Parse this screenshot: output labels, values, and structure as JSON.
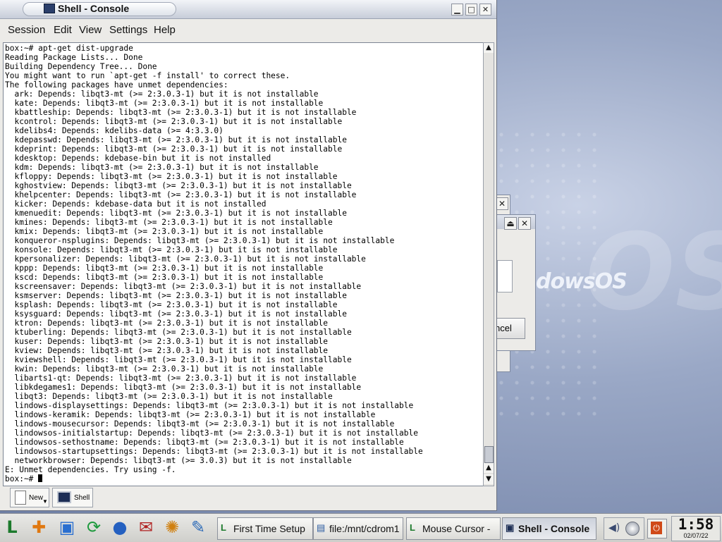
{
  "window": {
    "title": "Shell - Console",
    "controls": {
      "minimize": "▁",
      "maximize": "□",
      "close": "✕"
    }
  },
  "menubar": {
    "items": [
      "Session",
      "Edit",
      "View",
      "Settings",
      "Help"
    ]
  },
  "terminal": {
    "lines": [
      "box:~# apt-get dist-upgrade",
      "Reading Package Lists... Done",
      "Building Dependency Tree... Done",
      "You might want to run `apt-get -f install' to correct these.",
      "The following packages have unmet dependencies:",
      "  ark: Depends: libqt3-mt (>= 2:3.0.3-1) but it is not installable",
      "  kate: Depends: libqt3-mt (>= 2:3.0.3-1) but it is not installable",
      "  kbattleship: Depends: libqt3-mt (>= 2:3.0.3-1) but it is not installable",
      "  kcontrol: Depends: libqt3-mt (>= 2:3.0.3-1) but it is not installable",
      "  kdelibs4: Depends: kdelibs-data (>= 4:3.3.0)",
      "  kdepasswd: Depends: libqt3-mt (>= 2:3.0.3-1) but it is not installable",
      "  kdeprint: Depends: libqt3-mt (>= 2:3.0.3-1) but it is not installable",
      "  kdesktop: Depends: kdebase-bin but it is not installed",
      "  kdm: Depends: libqt3-mt (>= 2:3.0.3-1) but it is not installable",
      "  kfloppy: Depends: libqt3-mt (>= 2:3.0.3-1) but it is not installable",
      "  kghostview: Depends: libqt3-mt (>= 2:3.0.3-1) but it is not installable",
      "  khelpcenter: Depends: libqt3-mt (>= 2:3.0.3-1) but it is not installable",
      "  kicker: Depends: kdebase-data but it is not installed",
      "  kmenuedit: Depends: libqt3-mt (>= 2:3.0.3-1) but it is not installable",
      "  kmines: Depends: libqt3-mt (>= 2:3.0.3-1) but it is not installable",
      "  kmix: Depends: libqt3-mt (>= 2:3.0.3-1) but it is not installable",
      "  konqueror-nsplugins: Depends: libqt3-mt (>= 2:3.0.3-1) but it is not installable",
      "  konsole: Depends: libqt3-mt (>= 2:3.0.3-1) but it is not installable",
      "  kpersonalizer: Depends: libqt3-mt (>= 2:3.0.3-1) but it is not installable",
      "  kppp: Depends: libqt3-mt (>= 2:3.0.3-1) but it is not installable",
      "  kscd: Depends: libqt3-mt (>= 2:3.0.3-1) but it is not installable",
      "  kscreensaver: Depends: libqt3-mt (>= 2:3.0.3-1) but it is not installable",
      "  ksmserver: Depends: libqt3-mt (>= 2:3.0.3-1) but it is not installable",
      "  ksplash: Depends: libqt3-mt (>= 2:3.0.3-1) but it is not installable",
      "  ksysguard: Depends: libqt3-mt (>= 2:3.0.3-1) but it is not installable",
      "  ktron: Depends: libqt3-mt (>= 2:3.0.3-1) but it is not installable",
      "  ktuberling: Depends: libqt3-mt (>= 2:3.0.3-1) but it is not installable",
      "  kuser: Depends: libqt3-mt (>= 2:3.0.3-1) but it is not installable",
      "  kview: Depends: libqt3-mt (>= 2:3.0.3-1) but it is not installable",
      "  kviewshell: Depends: libqt3-mt (>= 2:3.0.3-1) but it is not installable",
      "  kwin: Depends: libqt3-mt (>= 2:3.0.3-1) but it is not installable",
      "  libarts1-qt: Depends: libqt3-mt (>= 2:3.0.3-1) but it is not installable",
      "  libkdegames1: Depends: libqt3-mt (>= 2:3.0.3-1) but it is not installable",
      "  libqt3: Depends: libqt3-mt (>= 2:3.0.3-1) but it is not installable",
      "  lindows-displaysettings: Depends: libqt3-mt (>= 2:3.0.3-1) but it is not installable",
      "  lindows-keramik: Depends: libqt3-mt (>= 2:3.0.3-1) but it is not installable",
      "  lindows-mousecursor: Depends: libqt3-mt (>= 2:3.0.3-1) but it is not installable",
      "  lindowsos-initialstartup: Depends: libqt3-mt (>= 2:3.0.3-1) but it is not installable",
      "  lindowsos-sethostname: Depends: libqt3-mt (>= 2:3.0.3-1) but it is not installable",
      "  lindowsos-startupsettings: Depends: libqt3-mt (>= 2:3.0.3-1) but it is not installable",
      "  networkbrowser: Depends: libqt3-mt (>= 3.0.3) but it is not installable",
      "E: Unmet dependencies. Try using -f.",
      "box:~# "
    ]
  },
  "scrollbar": {
    "up": "▲",
    "down": "▼",
    "down2": "▼▲"
  },
  "console_tabs": [
    {
      "label": "New",
      "icon": "new-doc-icon"
    },
    {
      "label": "Shell",
      "icon": "monitor-icon"
    }
  ],
  "background_windows": {
    "cancel_label": "ncel",
    "close": "✕",
    "shade": "⏏"
  },
  "wallpaper": {
    "logo_text": "dowsOS",
    "big_text": "OS"
  },
  "taskbar": {
    "quick_launch": [
      {
        "name": "launcher-icon",
        "glyph": "L"
      },
      {
        "name": "lifesaver-icon",
        "glyph": "✚"
      },
      {
        "name": "warehouse-icon",
        "glyph": "▣"
      },
      {
        "name": "runner-icon",
        "glyph": "⟳"
      },
      {
        "name": "browser-globe-icon",
        "glyph": "●"
      },
      {
        "name": "mail-icon",
        "glyph": "✉"
      },
      {
        "name": "people-icon",
        "glyph": "✺"
      },
      {
        "name": "pencil-icon",
        "glyph": "✎"
      }
    ],
    "tasks": [
      {
        "label": "First Time Setup",
        "icon": "L",
        "active": false
      },
      {
        "label": "file:/mnt/cdrom1",
        "icon": "▤",
        "active": false
      },
      {
        "label": "Mouse Cursor -",
        "icon": "L",
        "active": false
      },
      {
        "label": "Shell - Console",
        "icon": "▣",
        "active": true
      }
    ],
    "tray": {
      "volume": "◀)",
      "power": "⏻"
    },
    "clock": {
      "time": "1:58",
      "date": "02/07/22"
    }
  }
}
